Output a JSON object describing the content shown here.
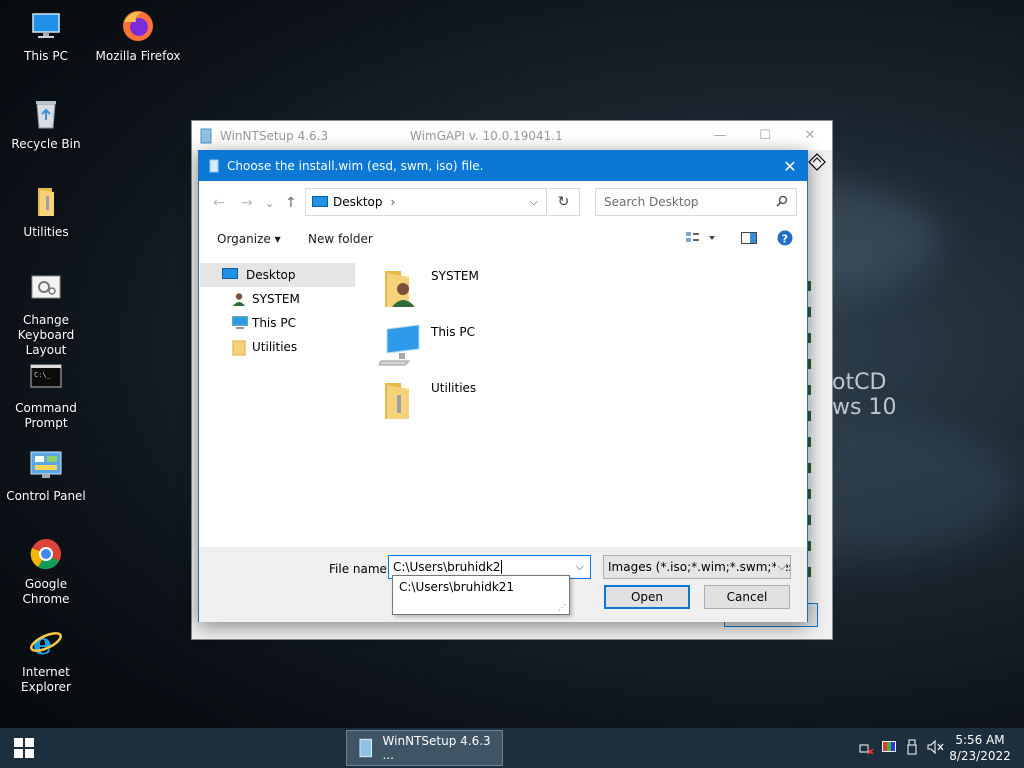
{
  "desktop": {
    "icons": [
      {
        "label": "This PC",
        "icon": "this-pc-icon"
      },
      {
        "label": "Mozilla Firefox",
        "icon": "firefox-icon"
      },
      {
        "label": "Recycle Bin",
        "icon": "recycle-bin-icon"
      },
      {
        "label": "Utilities",
        "icon": "folder-icon"
      },
      {
        "label": "Change Keyboard Layout",
        "icon": "keyboard-settings-icon"
      },
      {
        "label": "Command Prompt",
        "icon": "command-prompt-icon"
      },
      {
        "label": "Control Panel",
        "icon": "control-panel-icon"
      },
      {
        "label": "Google Chrome",
        "icon": "chrome-icon"
      },
      {
        "label": "Internet Explorer",
        "icon": "internet-explorer-icon"
      }
    ],
    "wallpaper_text_1": "otCD",
    "wallpaper_text_2": "ws 10"
  },
  "main_window": {
    "title": "WinNTSetup 4.6.3",
    "wimgapi": "WimGAPI v. 10.0.19041.1"
  },
  "dialog": {
    "title": "Choose the install.wim (esd, swm, iso) file.",
    "address": "Desktop",
    "search_placeholder": "Search Desktop",
    "organize_label": "Organize ▾",
    "new_folder_label": "New folder",
    "nav_items": [
      {
        "label": "Desktop",
        "icon": "desktop-icon",
        "selected": true
      },
      {
        "label": "SYSTEM",
        "icon": "user-icon",
        "selected": false
      },
      {
        "label": "This PC",
        "icon": "this-pc-icon",
        "selected": false
      },
      {
        "label": "Utilities",
        "icon": "folder-icon",
        "selected": false
      }
    ],
    "content_items": [
      {
        "label": "SYSTEM",
        "icon": "user-folder-icon"
      },
      {
        "label": "This PC",
        "icon": "this-pc-icon"
      },
      {
        "label": "Utilities",
        "icon": "folder-icon"
      }
    ],
    "file_name_label": "File name:",
    "file_name_value": "C:\\Users\\bruhidk2",
    "filter_value": "Images (*.iso;*.wim;*.swm;*.esd)",
    "autosuggest": "C:\\Users\\bruhidk21",
    "open_label": "Open",
    "cancel_label": "Cancel"
  },
  "taskbar": {
    "app_label": "WinNTSetup 4.6.3  ...",
    "time": "5:56 AM",
    "date": "8/23/2022"
  },
  "colors": {
    "accent": "#0a78d4",
    "taskbar": "#1d2f3c",
    "nav_selected": "#e5e5e5"
  }
}
